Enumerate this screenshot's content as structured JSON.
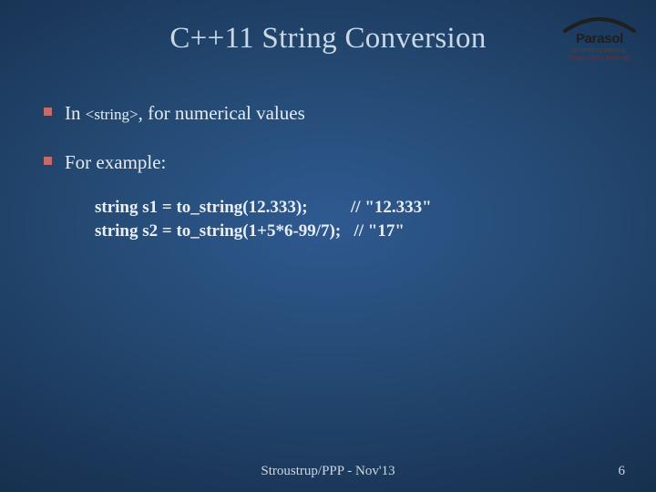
{
  "title": "C++11 String Conversion",
  "logo": {
    "brand": "Parasol",
    "sub": "Smarter computing.",
    "sub2": "Texas A&M University"
  },
  "bullets": {
    "b1_pre": "In ",
    "b1_mono": "<string>",
    "b1_post": ", for numerical values",
    "b2": "For example:"
  },
  "code": {
    "l1": "string s1 = to_string(12.333);          // \"12.333\"",
    "l2": "string s2 = to_string(1+5*6-99/7);   // \"17\""
  },
  "footer": {
    "credit": "Stroustrup/PPP - Nov'13",
    "page": "6"
  }
}
